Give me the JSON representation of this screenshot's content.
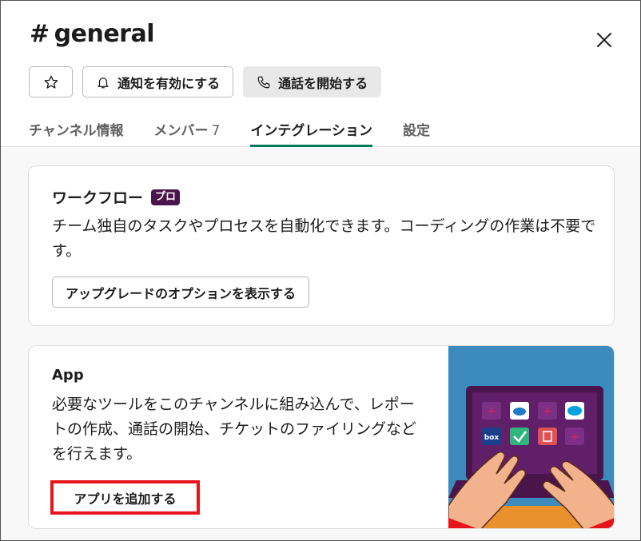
{
  "channel": {
    "hash": "#",
    "name": "general"
  },
  "header_buttons": {
    "star_icon": "star-icon",
    "notify_label": "通知を有効にする",
    "call_label": "通話を開始する"
  },
  "tabs": [
    {
      "label": "チャンネル情報"
    },
    {
      "label": "メンバー",
      "count": "7"
    },
    {
      "label": "インテグレーション",
      "active": true
    },
    {
      "label": "設定"
    }
  ],
  "workflow": {
    "title": "ワークフロー",
    "badge": "プロ",
    "description": "チーム独自のタスクやプロセスを自動化できます。コーディングの作業は不要です。",
    "button_label": "アップグレードのオプションを表示する"
  },
  "apps": {
    "title": "App",
    "description": "必要なツールをこのチャンネルに組み込んで、レポートの作成、通話の開始、チケットのファイリングなどを行えます。",
    "button_label": "アプリを追加する",
    "illustration_logos": [
      "box",
      "salesforce"
    ]
  },
  "colors": {
    "accent_tab": "#007a5a",
    "badge_bg": "#4a154b",
    "highlight": "#e8141c",
    "illustration_bg": "#3c8bbf",
    "laptop": "#4a154b"
  }
}
